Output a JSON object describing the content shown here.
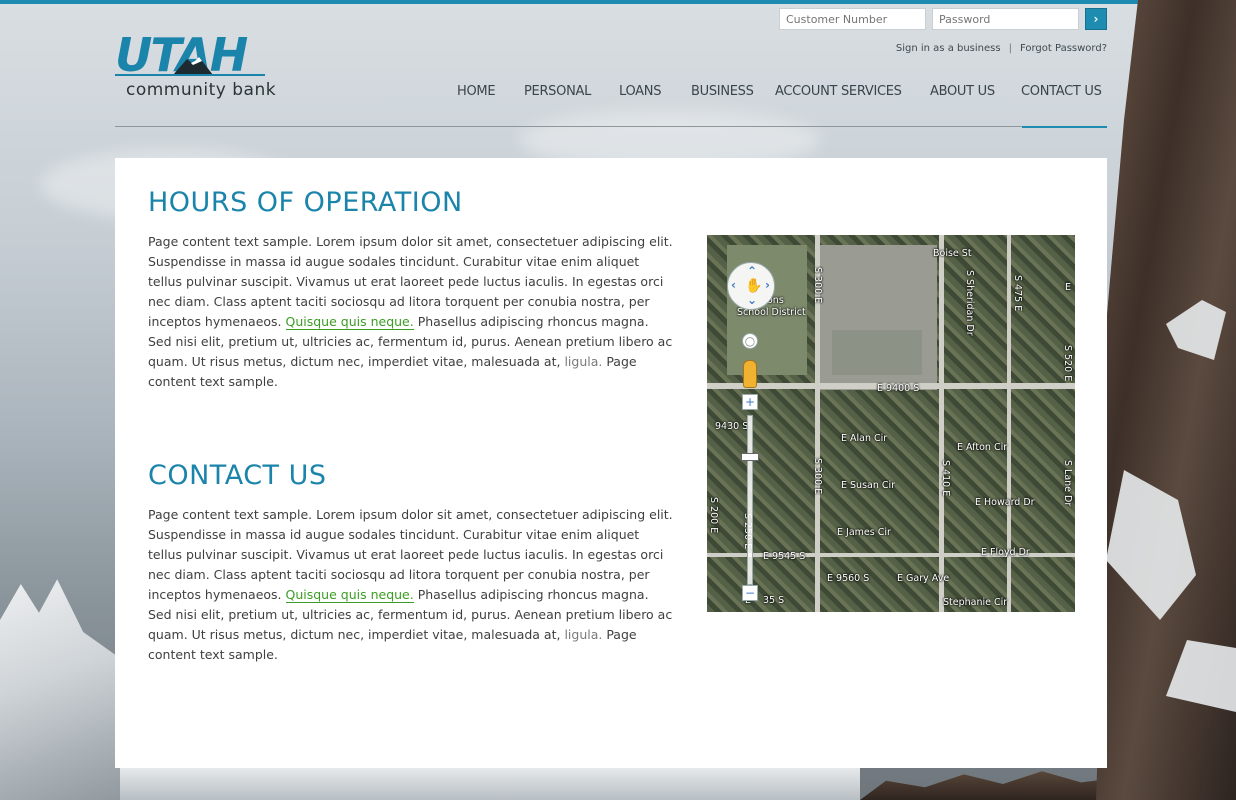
{
  "header": {
    "login": {
      "customer_placeholder": "Customer Number",
      "password_placeholder": "Password",
      "submit_icon": "chevron-right-icon"
    },
    "links": {
      "signin": "Sign in as a business",
      "separator": "|",
      "forgot": "Forgot Password?"
    },
    "logo": {
      "wordmark": "UTAH",
      "tagline": "community bank"
    },
    "nav": [
      {
        "label": "HOME"
      },
      {
        "label": "PERSONAL"
      },
      {
        "label": "LOANS"
      },
      {
        "label": "BUSINESS"
      },
      {
        "label": "ACCOUNT SERVICES"
      },
      {
        "label": "ABOUT US"
      },
      {
        "label": "CONTACT US",
        "active": true
      }
    ]
  },
  "main": {
    "hours": {
      "title": "HOURS OF OPERATION",
      "text_before": "Page content text sample. Lorem ipsum dolor sit amet, consectetuer  adipiscing elit. Suspendisse in massa id augue sodales tincidunt. Curabitur vitae enim aliquet tellus pulvinar suscipit. Vivamus ut erat laoreet pede luctus iaculis. In egestas orci nec diam. Class aptent taciti sociosqu ad litora torquent per conubia nostra, per inceptos hymenaeos. ",
      "link1": "Quisque quis neque.",
      "text_middle": " Phasellus adipiscing rhoncus magna. Sed nisi elit, pretium ut, ultricies ac, fermentum id, purus. Aenean pretium libero ac quam. Ut risus metus, dictum nec, imperdiet vitae, malesuada at, ",
      "link2": "ligula.",
      "text_after": " Page content text sample."
    },
    "contact": {
      "title": "CONTACT US",
      "text_before": "Page content text sample. Lorem ipsum dolor sit amet, consectetuer  adipiscing elit. Suspendisse in massa id augue sodales tincidunt. Curabitur vitae enim aliquet tellus pulvinar suscipit. Vivamus ut erat laoreet pede luctus iaculis. In egestas orci nec diam. Class aptent taciti sociosqu ad litora torquent per conubia nostra, per inceptos hymenaeos. ",
      "link1": "Quisque quis neque.",
      "text_middle": " Phasellus adipiscing rhoncus magna. Sed nisi elit, pretium ut, ultricies ac, fermentum id, purus. Aenean pretium libero ac quam. Ut risus metus, dictum nec, imperdiet vitae, malesuada at, ",
      "link2": "ligula.",
      "text_after": " Page content text sample."
    },
    "map": {
      "labels": {
        "boise": "Boise St",
        "s300e_top": "S 300 E",
        "sheridan": "S Sheridan Dr",
        "s475e": "S 475 E",
        "e_top": "E",
        "school1": "ons",
        "school2": "School District",
        "s520e": "S 520 E",
        "e9400s": "E 9400 S",
        "w9430s": "9430 S",
        "alan": "E Alan Cir",
        "afton": "E Afton Cir",
        "s300e_mid": "S 300 E",
        "s410e": "S 410 E",
        "lane": "S Lane Dr",
        "susan": "E Susan Cir",
        "howard": "E Howard Dr",
        "james": "E James Cir",
        "e9545s": "E 9545 S",
        "floyd": "E Floyd Dr",
        "e9560s": "E 9560 S",
        "gary": "E Gary Ave",
        "e35s": "E",
        "e35s_b": "35 S",
        "stephanie": "Stephanie Cir",
        "s200e": "S 200 E",
        "s250e": "S 250 E"
      },
      "controls": {
        "pan": "pan-control-icon",
        "zoom_in": "+",
        "zoom_out": "−",
        "pegman": "pegman-icon"
      }
    }
  },
  "colors": {
    "accent": "#1b84ab",
    "link_green": "#3a9d22",
    "text": "#3f3f3f"
  }
}
